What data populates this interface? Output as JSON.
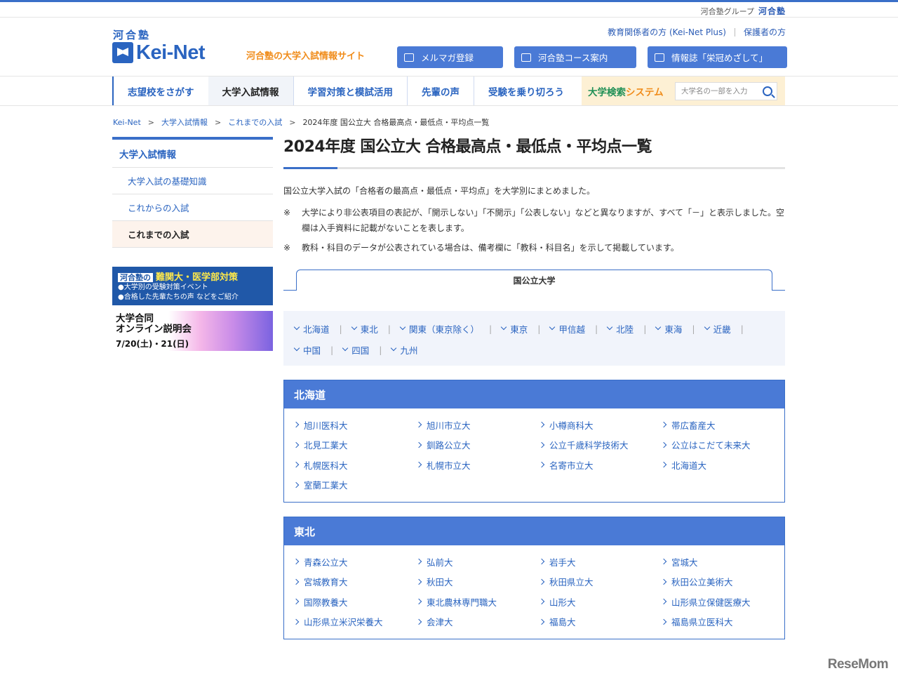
{
  "header": {
    "group_label": "河合塾グループ",
    "group_logo": "河合塾",
    "logo_kanji": "河合塾",
    "logo_text": "Kei-Net",
    "tagline": "河合塾の大学入試情報サイト",
    "top_links": [
      "教育関係者の方 (Kei-Net Plus)",
      "保護者の方"
    ],
    "buttons": [
      {
        "label": "メルマガ登録",
        "icon": "mail-icon"
      },
      {
        "label": "河合塾コース案内",
        "icon": "grid-icon"
      },
      {
        "label": "情報誌「栄冠めざして」",
        "icon": "book-icon"
      }
    ]
  },
  "gnav": {
    "items": [
      "志望校をさがす",
      "大学入試情報",
      "学習対策と模試活用",
      "先輩の声",
      "受験を乗り切ろう"
    ],
    "active_index": 1,
    "search_label_a": "大学検索",
    "search_label_b": "システム",
    "search_placeholder": "大学名の一部を入力"
  },
  "breadcrumb": [
    "Kei-Net",
    "大学入試情報",
    "これまでの入試",
    "2024年度 国公立大 合格最高点・最低点・平均点一覧"
  ],
  "sidebar": {
    "title": "大学入試情報",
    "items": [
      "大学入試の基礎知識",
      "これからの入試",
      "これまでの入試"
    ],
    "current_index": 2
  },
  "banners": {
    "b1_tag": "河合塾の",
    "b1_title": "難関大・医学部対策",
    "b1_line1": "●大学別の受験対策イベント",
    "b1_line2": "●合格した先輩たちの声 などをご紹介",
    "b2_title1": "大学合同",
    "b2_title2": "オンライン説明会",
    "b2_date": "7/20(土)・21(日)"
  },
  "main": {
    "title": "2024年度 国公立大 合格最高点・最低点・平均点一覧",
    "lead": "国公立大学入試の「合格者の最高点・最低点・平均点」を大学別にまとめました。",
    "notes": [
      "大学により非公表項目の表記が、「開示しない」「不開示」「公表しない」などと異なりますが、すべて「－」と表示しました。空欄は入手資料に記載がないことを表します。",
      "教科・科目のデータが公表されている場合は、備考欄に「教科・科目名」を示して掲載しています。"
    ],
    "note_mark": "※",
    "tab": "国公立大学",
    "regions_nav": [
      "北海道",
      "東北",
      "関東（東京除く）",
      "東京",
      "甲信越",
      "北陸",
      "東海",
      "近畿",
      "中国",
      "四国",
      "九州"
    ],
    "regions": [
      {
        "name": "北海道",
        "univs": [
          "旭川医科大",
          "旭川市立大",
          "小樽商科大",
          "帯広畜産大",
          "北見工業大",
          "釧路公立大",
          "公立千歳科学技術大",
          "公立はこだて未来大",
          "札幌医科大",
          "札幌市立大",
          "名寄市立大",
          "北海道大",
          "室蘭工業大"
        ]
      },
      {
        "name": "東北",
        "univs": [
          "青森公立大",
          "弘前大",
          "岩手大",
          "宮城大",
          "宮城教育大",
          "秋田大",
          "秋田県立大",
          "秋田公立美術大",
          "国際教養大",
          "東北農林専門職大",
          "山形大",
          "山形県立保健医療大",
          "山形県立米沢栄養大",
          "会津大",
          "福島大",
          "福島県立医科大"
        ]
      }
    ]
  },
  "watermark": "ReseMom"
}
